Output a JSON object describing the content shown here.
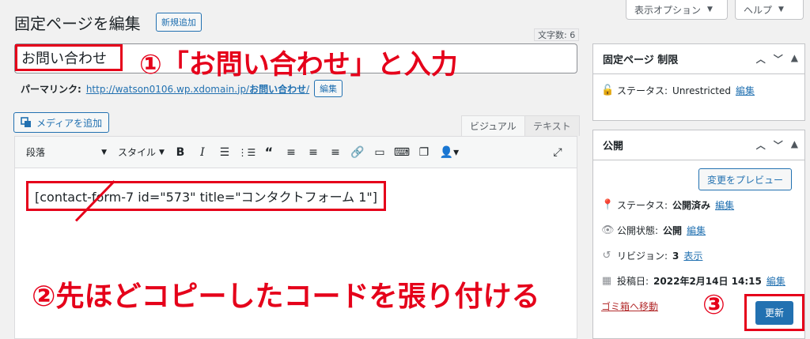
{
  "top": {
    "screen_options": "表示オプション",
    "help": "ヘルプ"
  },
  "header": {
    "title": "固定ページを編集",
    "new_button": "新規追加"
  },
  "title_field": {
    "char_count": "文字数: 6",
    "value": "お問い合わせ"
  },
  "permalink": {
    "label": "パーマリンク:",
    "url": "http://watson0106.wp.xdomain.jp/",
    "slug": "お問い合わせ",
    "trailing": "/",
    "edit_button": "編集"
  },
  "editor": {
    "add_media": "メディアを追加",
    "tab_visual": "ビジュアル",
    "tab_text": "テキスト",
    "format_select": "段落",
    "style_select": "スタイル",
    "content": "[contact-form-7 id=\"573\" title=\"コンタクトフォーム 1\"]"
  },
  "annotations": {
    "step1": "①「お問い合わせ」と入力",
    "step2": "②先ほどコピーしたコードを張り付ける",
    "step3": "③"
  },
  "sidebar": {
    "restrict": {
      "title": "固定ページ 制限",
      "status_label": "ステータス:",
      "status_value": "Unrestricted",
      "edit": "編集"
    },
    "publish": {
      "title": "公開",
      "preview_button": "変更をプレビュー",
      "status_label": "ステータス:",
      "status_value": "公開済み",
      "visibility_label": "公開状態:",
      "visibility_value": "公開",
      "revisions_label": "リビジョン:",
      "revisions_value": "3",
      "revisions_link": "表示",
      "date_label": "投稿日:",
      "date_value": "2022年2月14日 14:15",
      "edit": "編集",
      "trash": "ゴミ箱へ移動",
      "update_button": "更新"
    }
  },
  "colors": {
    "accent": "#2271b1",
    "annotation": "#e5001a",
    "danger": "#b32d2e"
  }
}
